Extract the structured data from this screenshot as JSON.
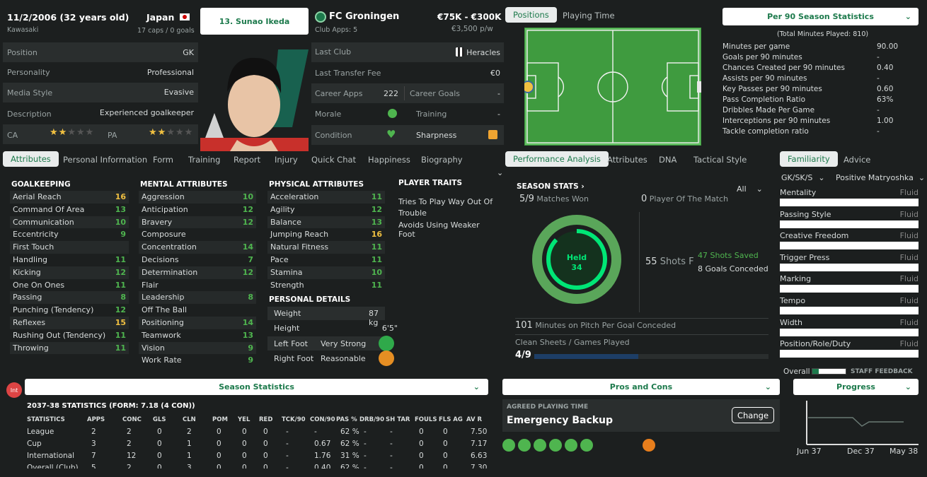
{
  "header": {
    "dob": "11/2/2006 (32 years old)",
    "birthplace": "Kawasaki",
    "nation": "Japan",
    "caps": "17 caps / 0 goals",
    "player_name": "13. Sunao Ikeda",
    "club": "FC Groningen",
    "club_apps": "Club Apps: 5",
    "value": "€75K - €300K",
    "wage": "€3,500 p/w"
  },
  "info": [
    {
      "label": "Position",
      "value": "GK"
    },
    {
      "label": "Personality",
      "value": "Professional"
    },
    {
      "label": "Media Style",
      "value": "Evasive"
    },
    {
      "label": "Description",
      "value": "Experienced goalkeeper"
    }
  ],
  "ca_label": "CA",
  "pa_label": "PA",
  "ca_stars": 2,
  "pa_stars": 2,
  "career": {
    "last_club_label": "Last Club",
    "last_club": "Heracles",
    "fee_label": "Last Transfer Fee",
    "fee": "€0",
    "apps_label": "Career Apps",
    "apps": "222",
    "goals_label": "Career Goals",
    "goals": "-",
    "morale_label": "Morale",
    "training_label": "Training",
    "training": "-",
    "condition_label": "Condition",
    "sharpness_label": "Sharpness"
  },
  "pitch_tabs": [
    "Positions",
    "Playing Time"
  ],
  "per90": {
    "dropdown": "Per 90 Season Statistics",
    "total": "(Total Minutes Played: 810)",
    "rows": [
      [
        "Minutes per game",
        "90.00"
      ],
      [
        "Goals per 90 minutes",
        "-"
      ],
      [
        "Chances Created per 90 minutes",
        "0.40"
      ],
      [
        "Assists per 90 minutes",
        "-"
      ],
      [
        "Key Passes per 90 minutes",
        "0.60"
      ],
      [
        "Pass Completion Ratio",
        "63%"
      ],
      [
        "Dribbles Made Per Game",
        "-"
      ],
      [
        "Interceptions per 90 minutes",
        "1.00"
      ],
      [
        "Tackle completion ratio",
        "-"
      ]
    ]
  },
  "tabs": [
    "Attributes",
    "Personal Information",
    "Form",
    "Training",
    "Report",
    "Injury",
    "Quick Chat",
    "Happiness",
    "Biography"
  ],
  "gk": {
    "title": "GOALKEEPING",
    "rows": [
      [
        "Aerial Reach",
        "16"
      ],
      [
        "Command Of Area",
        "13"
      ],
      [
        "Communication",
        "10"
      ],
      [
        "Eccentricity",
        "9"
      ],
      [
        "First Touch",
        ""
      ],
      [
        "Handling",
        "11"
      ],
      [
        "Kicking",
        "12"
      ],
      [
        "One On Ones",
        "11"
      ],
      [
        "Passing",
        "8"
      ],
      [
        "Punching (Tendency)",
        "12"
      ],
      [
        "Reflexes",
        "15"
      ],
      [
        "Rushing Out (Tendency)",
        "11"
      ],
      [
        "Throwing",
        "11"
      ]
    ]
  },
  "mental": {
    "title": "MENTAL ATTRIBUTES",
    "rows": [
      [
        "Aggression",
        "10"
      ],
      [
        "Anticipation",
        "12"
      ],
      [
        "Bravery",
        "12"
      ],
      [
        "Composure",
        ""
      ],
      [
        "Concentration",
        "14"
      ],
      [
        "Decisions",
        "7"
      ],
      [
        "Determination",
        "12"
      ],
      [
        "Flair",
        ""
      ],
      [
        "Leadership",
        "8"
      ],
      [
        "Off The Ball",
        ""
      ],
      [
        "Positioning",
        "14"
      ],
      [
        "Teamwork",
        "13"
      ],
      [
        "Vision",
        "9"
      ],
      [
        "Work Rate",
        "9"
      ]
    ]
  },
  "physical": {
    "title": "PHYSICAL ATTRIBUTES",
    "rows": [
      [
        "Acceleration",
        "11"
      ],
      [
        "Agility",
        "12"
      ],
      [
        "Balance",
        "13"
      ],
      [
        "Jumping Reach",
        "16"
      ],
      [
        "Natural Fitness",
        "11"
      ],
      [
        "Pace",
        "11"
      ],
      [
        "Stamina",
        "10"
      ],
      [
        "Strength",
        "11"
      ]
    ]
  },
  "personal": {
    "title": "PERSONAL DETAILS",
    "weight_label": "Weight",
    "weight": "87 kg",
    "height_label": "Height",
    "height": "6'5\"",
    "left_label": "Left Foot",
    "left": "Very Strong",
    "right_label": "Right Foot",
    "right": "Reasonable"
  },
  "traits": {
    "title": "PLAYER TRAITS",
    "items": [
      "Tries To Play Way Out Of Trouble",
      "Avoids Using Weaker Foot"
    ]
  },
  "perf_tabs": [
    "Performance Analysis",
    "Attributes",
    "DNA",
    "Tactical Style"
  ],
  "season": {
    "title": "SEASON STATS",
    "filter": "All",
    "won": "5/9",
    "won_label": "Matches Won",
    "potm": "0",
    "potm_label": "Player Of The Match",
    "held_label": "Held",
    "held": "34",
    "held_fraction": 0.87,
    "shots": "55",
    "shots_label": "Shots F",
    "saved": "47",
    "saved_label": "Shots Saved",
    "conceded": "8",
    "conceded_label": "Goals Conceded",
    "mins": "101",
    "mins_label": "Minutes on Pitch Per Goal Conceded",
    "cs_label": "Clean Sheets / Games Played",
    "cs": "4/9",
    "cs_fraction": 0.444
  },
  "fam_tabs": [
    "Familiarity",
    "Advice"
  ],
  "fam": {
    "role": "GK/SK/S",
    "system": "Positive Matryoshka",
    "rows": [
      [
        "Mentality",
        "Fluid"
      ],
      [
        "Passing Style",
        "Fluid"
      ],
      [
        "Creative Freedom",
        "Fluid"
      ],
      [
        "Trigger Press",
        "Fluid"
      ],
      [
        "Marking",
        "Fluid"
      ],
      [
        "Tempo",
        "Fluid"
      ],
      [
        "Width",
        "Fluid"
      ],
      [
        "Position/Role/Duty",
        "Fluid"
      ]
    ],
    "overall": "Overall",
    "feedback": "STAFF FEEDBACK"
  },
  "season_stats": {
    "badge": "Int",
    "dropdown": "Season Statistics",
    "title": "2037-38 STATISTICS (FORM: 7.18 (4 CON))",
    "headers": [
      "STATISTICS",
      "APPS",
      "CONC",
      "GLS",
      "CLN",
      "POM",
      "YEL",
      "RED",
      "TCK/90",
      "CON/90",
      "PAS %",
      "DRB/90",
      "SH TAR",
      "FOULS",
      "FLS AG",
      "AV R"
    ],
    "rows": [
      [
        "League",
        "2",
        "2",
        "0",
        "2",
        "0",
        "0",
        "0",
        "-",
        "-",
        "62 %",
        "-",
        "-",
        "0",
        "0",
        "7.50"
      ],
      [
        "Cup",
        "3",
        "2",
        "0",
        "1",
        "0",
        "0",
        "0",
        "-",
        "0.67",
        "62 %",
        "-",
        "-",
        "0",
        "0",
        "7.17"
      ],
      [
        "International",
        "7",
        "12",
        "0",
        "1",
        "0",
        "0",
        "0",
        "-",
        "1.76",
        "31 %",
        "-",
        "-",
        "0",
        "0",
        "6.63"
      ],
      [
        "Overall (Club)",
        "5",
        "2",
        "0",
        "3",
        "0",
        "0",
        "0",
        "-",
        "0.40",
        "62 %",
        "-",
        "-",
        "0",
        "0",
        "7.30"
      ]
    ]
  },
  "pros": {
    "dropdown": "Pros and Cons",
    "agreed_label": "AGREED PLAYING TIME",
    "agreed": "Emergency Backup",
    "change": "Change"
  },
  "progress": {
    "dropdown": "Progress",
    "labels": [
      "Jun 37",
      "Dec 37",
      "May 38"
    ]
  },
  "colors": {
    "green": "#4fb54f",
    "yellow": "#f0c041",
    "accent": "#1d7a4c",
    "pitch": "#3f9b3f",
    "ring": "#00e676"
  }
}
